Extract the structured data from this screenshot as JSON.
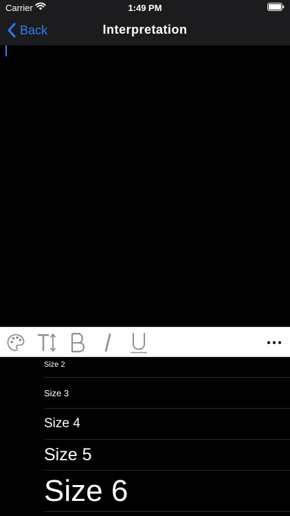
{
  "status_bar": {
    "carrier": "Carrier",
    "time": "1:49 PM"
  },
  "nav_bar": {
    "back_label": "Back",
    "title": "Interpretation"
  },
  "colors": {
    "accent": "#2f7cf6",
    "cursor": "#4a73f0",
    "toolbar_icon": "#8e8e93"
  },
  "toolbar": {
    "icons": [
      "palette-icon",
      "text-size-icon",
      "bold-icon",
      "italic-icon",
      "underline-icon",
      "more-icon"
    ]
  },
  "size_options": [
    {
      "label": "Size 2"
    },
    {
      "label": "Size 3"
    },
    {
      "label": "Size 4"
    },
    {
      "label": "Size 5"
    },
    {
      "label": "Size 6"
    }
  ]
}
